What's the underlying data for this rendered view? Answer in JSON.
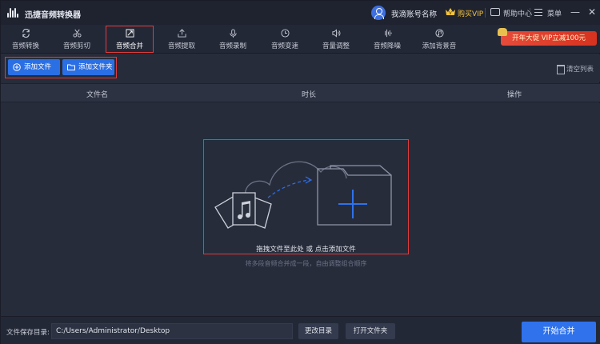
{
  "app": {
    "title": "迅捷音频转换器"
  },
  "header": {
    "account_name": "我滴账号名称",
    "vip_label": "购买VIP",
    "help_label": "帮助中心",
    "menu_label": "菜单",
    "minimize_glyph": "—",
    "close_glyph": "✕"
  },
  "toolbar": {
    "items": [
      {
        "label": "音频转换",
        "icon": "convert-icon"
      },
      {
        "label": "音频剪切",
        "icon": "scissors-icon"
      },
      {
        "label": "音频合并",
        "icon": "merge-icon",
        "active": true
      },
      {
        "label": "音频提取",
        "icon": "extract-icon"
      },
      {
        "label": "音频录制",
        "icon": "mic-icon"
      },
      {
        "label": "音频变速",
        "icon": "speed-icon"
      },
      {
        "label": "音量调整",
        "icon": "volume-icon"
      },
      {
        "label": "音频降噪",
        "icon": "noise-icon"
      },
      {
        "label": "添加背景音",
        "icon": "bgmusic-icon"
      }
    ],
    "promo_label": "开年大促 VIP立减100元"
  },
  "actions": {
    "add_file": "添加文件",
    "add_folder": "添加文件夹",
    "clear_list": "清空列表"
  },
  "table": {
    "col_filename": "文件名",
    "col_duration": "时长",
    "col_actions": "操作"
  },
  "dropzone": {
    "text": "拖拽文件至此处 或 点击添加文件",
    "hint": "将多段音频合并成一段，自由调整组合顺序"
  },
  "footer": {
    "save_dir_label": "文件保存目录:",
    "save_path": "C:/Users/Administrator/Desktop",
    "change_dir": "更改目录",
    "open_folder": "打开文件夹",
    "start": "开始合并"
  },
  "colors": {
    "accent": "#2f72ec",
    "highlight_frame": "#e03b3b",
    "vip": "#f4c23c",
    "background": "#272c3b"
  }
}
